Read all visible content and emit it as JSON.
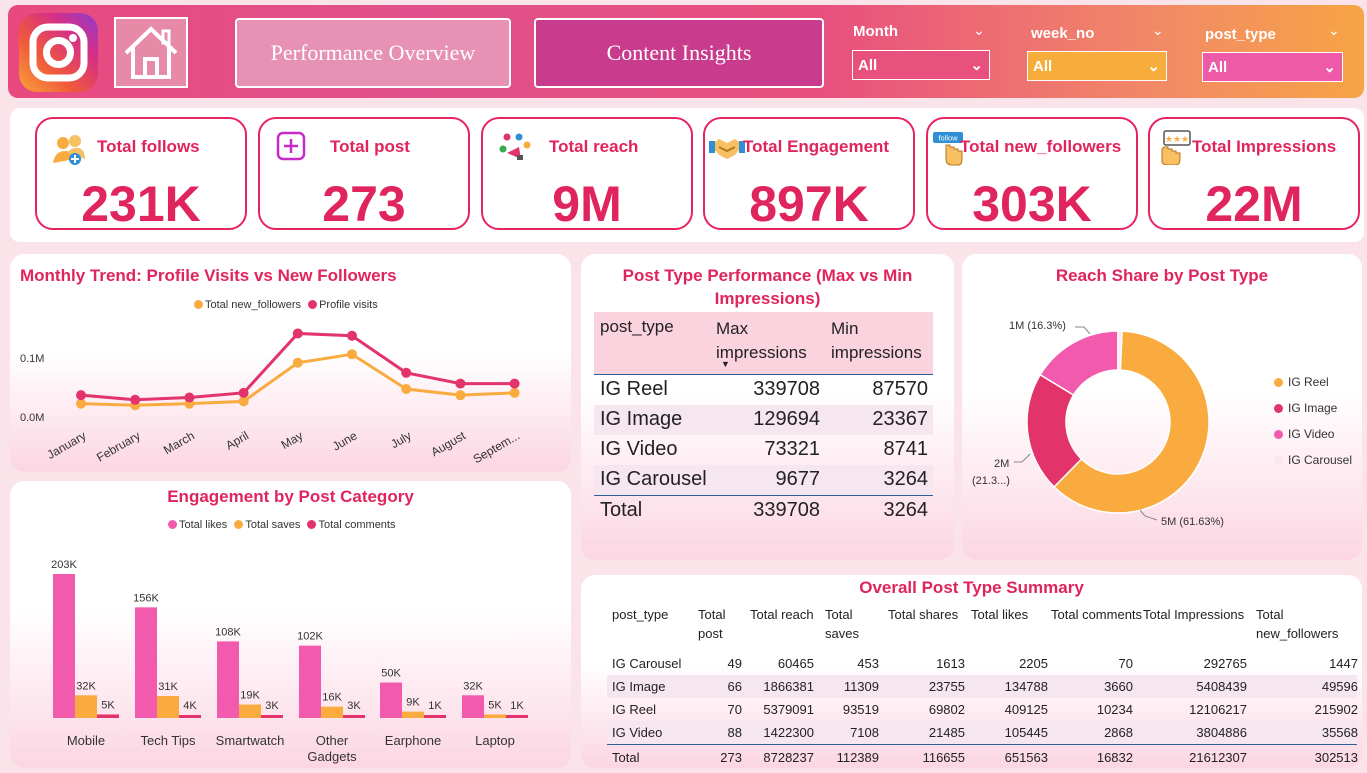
{
  "header": {
    "nav_buttons": [
      "Performance Overview",
      "Content Insights"
    ],
    "filters": [
      {
        "label": "Month",
        "value": "All"
      },
      {
        "label": "week_no",
        "value": "All"
      },
      {
        "label": "post_type",
        "value": "All"
      }
    ]
  },
  "kpis": [
    {
      "title": "Total follows",
      "value": "231K",
      "icon": "users-plus-icon"
    },
    {
      "title": "Total post",
      "value": "273",
      "icon": "plus-square-icon"
    },
    {
      "title": "Total reach",
      "value": "9M",
      "icon": "megaphone-people-icon"
    },
    {
      "title": "Total Engagement",
      "value": "897K",
      "icon": "handshake-icon"
    },
    {
      "title": "Total new_followers",
      "value": "303K",
      "icon": "follow-badge-icon"
    },
    {
      "title": "Total Impressions",
      "value": "22M",
      "icon": "click-rating-icon"
    }
  ],
  "monthly_trend": {
    "title": "Monthly Trend: Profile Visits vs New Followers",
    "legend": [
      "Total new_followers",
      "Profile visits"
    ],
    "y_ticks": [
      "0.1M",
      "0.0M"
    ],
    "chart_data": {
      "type": "line",
      "categories": [
        "January",
        "February",
        "March",
        "April",
        "May",
        "June",
        "July",
        "August",
        "Septem..."
      ],
      "series": [
        {
          "name": "Total new_followers",
          "color": "#f9ab3f",
          "values": [
            16000,
            14000,
            16000,
            19000,
            69000,
            80000,
            35000,
            27000,
            30000
          ]
        },
        {
          "name": "Profile visits",
          "color": "#e2346b",
          "values": [
            27000,
            21000,
            24000,
            30000,
            107000,
            104000,
            56000,
            42000,
            42000
          ]
        }
      ],
      "ylim": [
        0,
        140000
      ]
    }
  },
  "post_type_perf": {
    "title": "Post Type Performance (Max vs Min Impressions)",
    "columns": [
      "post_type",
      "Max impressions",
      "Min impressions"
    ],
    "rows": [
      [
        "IG Reel",
        "339708",
        "87570"
      ],
      [
        "IG Image",
        "129694",
        "23367"
      ],
      [
        "IG Video",
        "73321",
        "8741"
      ],
      [
        "IG Carousel",
        "9677",
        "3264"
      ]
    ],
    "total": [
      "Total",
      "339708",
      "3264"
    ]
  },
  "reach_share": {
    "title": "Reach Share by Post Type",
    "chart_data": {
      "type": "pie",
      "slices": [
        {
          "name": "IG Reel",
          "value": 61.63,
          "label": "5M (61.63%)",
          "color": "#f9ab3f"
        },
        {
          "name": "IG Image",
          "value": 21.3,
          "label": "2M (21.3...)",
          "color": "#e2346b"
        },
        {
          "name": "IG Video",
          "value": 16.3,
          "label": "1M (16.3%)",
          "color": "#f25aad"
        },
        {
          "name": "IG Carousel",
          "value": 0.7,
          "label": "",
          "color": "#fbe6ec"
        }
      ]
    }
  },
  "engagement": {
    "title": "Engagement by Post Category",
    "legend": [
      "Total likes",
      "Total saves",
      "Total comments"
    ],
    "chart_data": {
      "type": "bar",
      "categories": [
        "Mobile",
        "Tech Tips",
        "Smartwatch",
        "Other Gadgets",
        "Earphone",
        "Laptop"
      ],
      "series": [
        {
          "name": "Total likes",
          "color": "#f25aad",
          "values": [
            203000,
            156000,
            108000,
            102000,
            50000,
            32000
          ],
          "labels": [
            "203K",
            "156K",
            "108K",
            "102K",
            "50K",
            "32K"
          ]
        },
        {
          "name": "Total saves",
          "color": "#f9ab3f",
          "values": [
            32000,
            31000,
            19000,
            16000,
            9000,
            5000
          ],
          "labels": [
            "32K",
            "31K",
            "19K",
            "16K",
            "9K",
            "5K"
          ]
        },
        {
          "name": "Total comments",
          "color": "#e2346b",
          "values": [
            5000,
            4000,
            3000,
            3000,
            1000,
            1000
          ],
          "labels": [
            "5K",
            "4K",
            "3K",
            "3K",
            "1K",
            "1K"
          ]
        }
      ],
      "ylim": [
        0,
        210000
      ]
    }
  },
  "summary": {
    "title": "Overall Post Type Summary",
    "columns": [
      "post_type",
      "Total post",
      "Total reach",
      "Total saves",
      "Total shares",
      "Total likes",
      "Total comments",
      "Total Impressions",
      "Total new_followers"
    ],
    "rows": [
      [
        "IG Carousel",
        "49",
        "60465",
        "453",
        "1613",
        "2205",
        "70",
        "292765",
        "1447"
      ],
      [
        "IG Image",
        "66",
        "1866381",
        "11309",
        "23755",
        "134788",
        "3660",
        "5408439",
        "49596"
      ],
      [
        "IG Reel",
        "70",
        "5379091",
        "93519",
        "69802",
        "409125",
        "10234",
        "12106217",
        "215902"
      ],
      [
        "IG Video",
        "88",
        "1422300",
        "7108",
        "21485",
        "105445",
        "2868",
        "3804886",
        "35568"
      ]
    ],
    "total": [
      "Total",
      "273",
      "8728237",
      "112389",
      "116655",
      "651563",
      "16832",
      "21612307",
      "302513"
    ]
  }
}
